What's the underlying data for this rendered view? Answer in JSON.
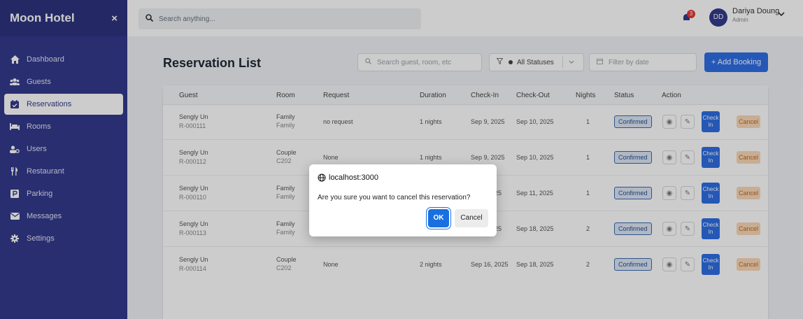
{
  "sidebar": {
    "brand": "Moon Hotel",
    "close": "×",
    "items": [
      {
        "label": "Dashboard",
        "icon": "home-icon"
      },
      {
        "label": "Guests",
        "icon": "users-icon"
      },
      {
        "label": "Reservations",
        "icon": "calendar-check-icon",
        "active": true
      },
      {
        "label": "Rooms",
        "icon": "bed-icon"
      },
      {
        "label": "Users",
        "icon": "user-settings-icon"
      },
      {
        "label": "Restaurant",
        "icon": "utensils-icon"
      },
      {
        "label": "Parking",
        "icon": "parking-icon"
      },
      {
        "label": "Messages",
        "icon": "envelope-icon"
      },
      {
        "label": "Settings",
        "icon": "gear-icon"
      }
    ]
  },
  "topbar": {
    "search_placeholder": "Search anything...",
    "notification_count": "3",
    "avatar_initials": "DD",
    "user_name": "Dariya Doung",
    "user_role": "Admin"
  },
  "page": {
    "title": "Reservation List",
    "search_placeholder": "Search guest, room, etc",
    "status_filter": "All Statuses",
    "date_placeholder": "Filter by date",
    "add_button": "+ Add Booking"
  },
  "table": {
    "headers": [
      "Guest",
      "Room",
      "Request",
      "Duration",
      "Check-In",
      "Check-Out",
      "Nights",
      "Status",
      "Action"
    ],
    "rows": [
      {
        "guest": "Sengly Un",
        "id": "R-000111",
        "room": "Family",
        "room_sub": "Family",
        "request": "no request",
        "duration": "1 nights",
        "checkin": "Sep 9, 2025",
        "checkout": "Sep 10, 2025",
        "nights": "1",
        "status": "Confirmed"
      },
      {
        "guest": "Sengly Un",
        "id": "R-000112",
        "room": "Couple",
        "room_sub": "C202",
        "request": "None",
        "duration": "1 nights",
        "checkin": "Sep 9, 2025",
        "checkout": "Sep 10, 2025",
        "nights": "1",
        "status": "Confirmed"
      },
      {
        "guest": "Sengly Un",
        "id": "R-000110",
        "room": "Family",
        "room_sub": "Family",
        "request": "",
        "duration": "",
        "checkin": "25",
        "checkout": "Sep 11, 2025",
        "nights": "1",
        "status": "Confirmed"
      },
      {
        "guest": "Sengly Un",
        "id": "R-000113",
        "room": "Family",
        "room_sub": "Family",
        "request": "",
        "duration": "",
        "checkin": "25",
        "checkout": "Sep 18, 2025",
        "nights": "2",
        "status": "Confirmed"
      },
      {
        "guest": "Sengly Un",
        "id": "R-000114",
        "room": "Couple",
        "room_sub": "C202",
        "request": "None",
        "duration": "2 nights",
        "checkin": "Sep 16, 2025",
        "checkout": "Sep 18, 2025",
        "nights": "2",
        "status": "Confirmed"
      }
    ],
    "checkin_label": "Check In",
    "cancel_label": "Cancel"
  },
  "dialog": {
    "host": "localhost:3000",
    "message": "Are you sure you want to cancel this reservation?",
    "ok": "OK",
    "cancel": "Cancel"
  },
  "colors": {
    "sidebar": "#333a8c",
    "primary": "#2f6fe4",
    "badge_red": "#e53935",
    "cancel_bg": "#fad9b7"
  }
}
